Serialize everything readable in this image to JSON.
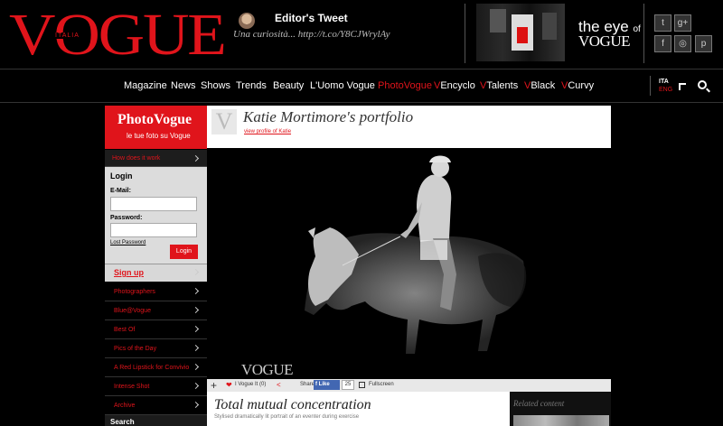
{
  "brand": {
    "logo": "VOGUE",
    "edition": "ITALIA"
  },
  "tweet": {
    "title": "Editor's Tweet",
    "text": "Una curiosità... http://t.co/Y8CJWrylAy"
  },
  "eye": {
    "line1": "the eye",
    "of": "of",
    "line2": "VOGUE"
  },
  "social": {
    "twitter": "t",
    "google_plus": "g+",
    "facebook": "f",
    "instagram": "◎",
    "pinterest": "p"
  },
  "nav": {
    "items": [
      {
        "label": "Magazine"
      },
      {
        "label": "News"
      },
      {
        "label": "Shows"
      },
      {
        "label": "Trends"
      },
      {
        "label": "Beauty"
      },
      {
        "label": "L'Uomo Vogue"
      },
      {
        "label": "PhotoVogue"
      },
      {
        "prefix": "V",
        "label": "Encyclo"
      },
      {
        "prefix": "V",
        "label": "Talents"
      },
      {
        "prefix": "V",
        "label": "Black"
      },
      {
        "prefix": "V",
        "label": "Curvy"
      }
    ],
    "lang_active": "ITA",
    "lang_other": "ENG"
  },
  "photovogue": {
    "title": "PhotoVogue",
    "subtitle": "le tue foto su Vogue",
    "how_it_works": "How does it work"
  },
  "login": {
    "title": "Login",
    "email_label": "E-Mail:",
    "password_label": "Password:",
    "lost_password": "Lost Password",
    "button": "Login",
    "signup": "Sign up"
  },
  "sidebar": {
    "items": [
      {
        "label": "Photographers"
      },
      {
        "label": "Blue@Vogue"
      },
      {
        "label": "Best Of"
      },
      {
        "label": "Pics of the Day"
      },
      {
        "label": "A Red Lipstick for Convivio"
      },
      {
        "label": "Intense Shot"
      },
      {
        "label": "Archive"
      }
    ],
    "search": "Search"
  },
  "portfolio": {
    "logo": "V",
    "title": "Katie Mortimore's portfolio",
    "profile_link": "view profile of Katie"
  },
  "photo": {
    "watermark": "VOGUE"
  },
  "actions": {
    "vogue_it": "I Vogue It (0)",
    "share": "Share",
    "like": "Like",
    "like_count": "25",
    "fullscreen": "Fullscreen"
  },
  "description": {
    "title": "Total mutual concentration",
    "subtitle": "Stylised dramatically lit portrait of an eventer during exercise"
  },
  "related": {
    "label": "Related content"
  },
  "colors": {
    "brand_red": "#e0141b",
    "facebook_blue": "#4267b2"
  }
}
